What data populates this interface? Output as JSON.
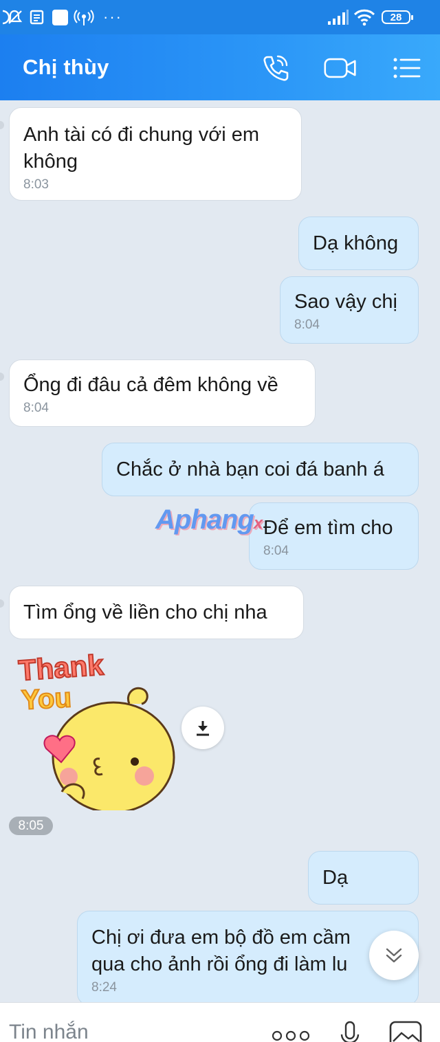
{
  "status_bar": {
    "battery": "28",
    "more": "···"
  },
  "header": {
    "contact_name": "Chị thùy",
    "icons": [
      "phone-icon",
      "video-call-icon",
      "menu-list-icon"
    ]
  },
  "messages": [
    {
      "direction": "in",
      "text": "Anh tài có đi chung với em không",
      "time": "8:03"
    },
    {
      "direction": "out",
      "text": "Dạ không",
      "time": ""
    },
    {
      "direction": "out",
      "text": "Sao vậy chị",
      "time": "8:04"
    },
    {
      "direction": "in",
      "text": "Ổng đi đâu cả đêm không về",
      "time": "8:04"
    },
    {
      "direction": "out",
      "text": "Chắc ở nhà bạn coi đá banh á",
      "time": ""
    },
    {
      "direction": "out",
      "text": "Để em tìm cho",
      "time": "8:04"
    },
    {
      "direction": "in",
      "text": "Tìm ổng về liền cho chị nha",
      "time": ""
    },
    {
      "direction": "in",
      "type": "sticker",
      "sticker_text": [
        "Thank",
        "You"
      ],
      "time": "8:05"
    },
    {
      "direction": "out",
      "text": "Dạ",
      "time": ""
    },
    {
      "direction": "out",
      "text": "Chị ơi đưa em bộ đồ em cầm qua cho ảnh rồi ổng đi làm lu",
      "time": "8:24"
    }
  ],
  "watermark": {
    "text": "Aphang",
    "suffix": "x"
  },
  "input_bar": {
    "placeholder": "Tin nhắn",
    "icons": [
      "more-options-icon",
      "microphone-icon",
      "image-icon"
    ]
  },
  "colors": {
    "header_bg": "#2b8ef2",
    "incoming_bubble": "#ffffff",
    "outgoing_bubble": "#d5ecfd",
    "chat_bg": "#e2e9f1"
  }
}
